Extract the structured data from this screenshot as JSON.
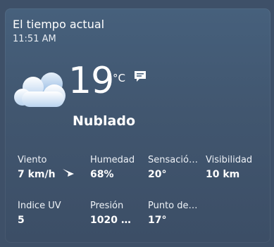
{
  "widget": {
    "title": "El tiempo actual",
    "time": "11:51 AM"
  },
  "current": {
    "temperature": "19",
    "unit": "°C",
    "condition": "Nublado",
    "icon": "cloud-icon"
  },
  "metrics": [
    {
      "label": "Viento",
      "value": "7 km/h"
    },
    {
      "label": "Humedad",
      "value": "68%"
    },
    {
      "label": "Sensació…",
      "value": "20°"
    },
    {
      "label": "Visibilidad",
      "value": "10 km"
    },
    {
      "label": "Índice UV",
      "value": "5"
    },
    {
      "label": "Presión",
      "value": "1020 m…"
    },
    {
      "label": "Punto de…",
      "value": "17°"
    }
  ],
  "colors": {
    "background": "#3e5068",
    "card_top": "#46607c",
    "card_bottom": "#3c4e66",
    "text": "#ffffff"
  }
}
